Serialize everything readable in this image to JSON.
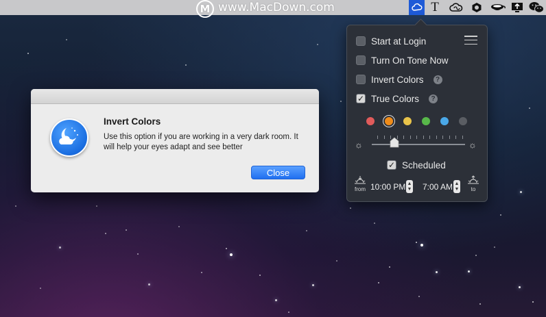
{
  "watermark": {
    "logo_letter": "M",
    "text": "www.MacDown.com"
  },
  "menubar_icons": [
    {
      "name": "tone-app-icon",
      "active": true
    },
    {
      "name": "text-icon",
      "glyph": "T"
    },
    {
      "name": "creative-cloud-icon"
    },
    {
      "name": "app-hexagon-icon"
    },
    {
      "name": "coffee-cup-icon"
    },
    {
      "name": "screen-upload-icon"
    },
    {
      "name": "wechat-icon"
    }
  ],
  "popover": {
    "options": [
      {
        "label": "Start at Login",
        "checked": false
      },
      {
        "label": "Turn On Tone Now",
        "checked": false
      },
      {
        "label": "Invert Colors",
        "checked": false,
        "help": "?"
      },
      {
        "label": "True Colors",
        "checked": true,
        "help": "?"
      }
    ],
    "color_swatches": [
      "#e05b5b",
      "#f08c1a",
      "#e8c34a",
      "#58b84a",
      "#4aa8e8",
      "#5a5d63"
    ],
    "selected_swatch": 1,
    "slider_level": 0.24,
    "scheduled": {
      "label": "Scheduled",
      "checked": true
    },
    "from_label": "from",
    "to_label": "to",
    "from_time": "10:00 PM",
    "to_time": "7:00 AM"
  },
  "dialog": {
    "title": "Invert Colors",
    "message": "Use this option if you are working in a very dark room. It will help your eyes adapt and see better",
    "close_label": "Close"
  },
  "colors": {
    "accent": "#1f6ff0",
    "popover_bg": "#2c3038",
    "menubar_bg": "#c8c8ca"
  }
}
